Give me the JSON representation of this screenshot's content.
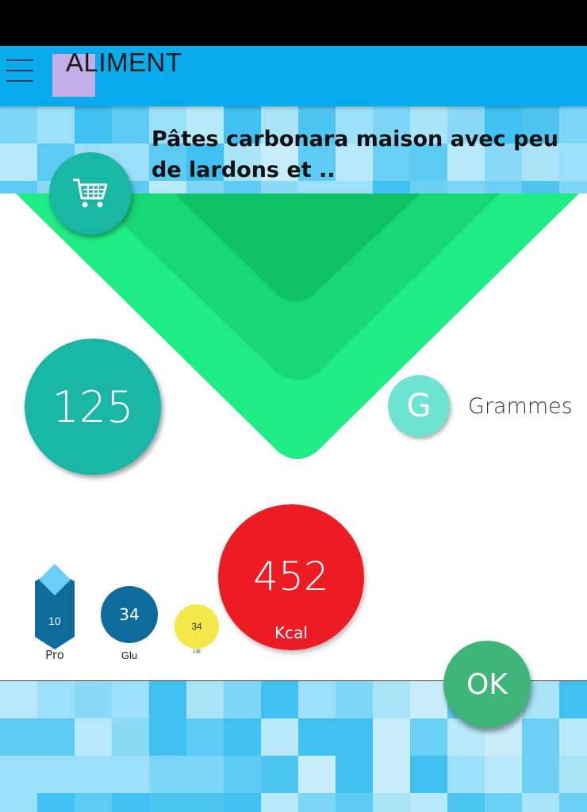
{
  "app_bar": {
    "title": "ALIMENT",
    "menu_icon": "hamburger-menu-icon",
    "background": "#0aabee",
    "logo_color": "#c3aee8"
  },
  "food": {
    "title": "Pâtes carbonara maison avec peu de lardons et ..",
    "cart_icon": "shopping-cart-icon"
  },
  "quantity": {
    "value": "125",
    "unit_symbol": "G",
    "unit_label": "Grammes"
  },
  "nutrition": {
    "kcal_value": "452",
    "kcal_label": "Kcal",
    "pro_value": "10",
    "pro_label": "Pro",
    "glu_value": "34",
    "glu_label": "Glu",
    "lip_value": "34",
    "lip_label": "Lip"
  },
  "actions": {
    "ok_label": "OK"
  },
  "colors": {
    "teal": "#1ab6a5",
    "kcal_red": "#ed1c24",
    "glu_blue": "#0e6b9b",
    "lip_yellow": "#f5e84a",
    "ok_green": "#3fb579",
    "funnel_outer": "#1fec85",
    "funnel_mid": "#17d676",
    "funnel_inner": "#0fc066"
  }
}
